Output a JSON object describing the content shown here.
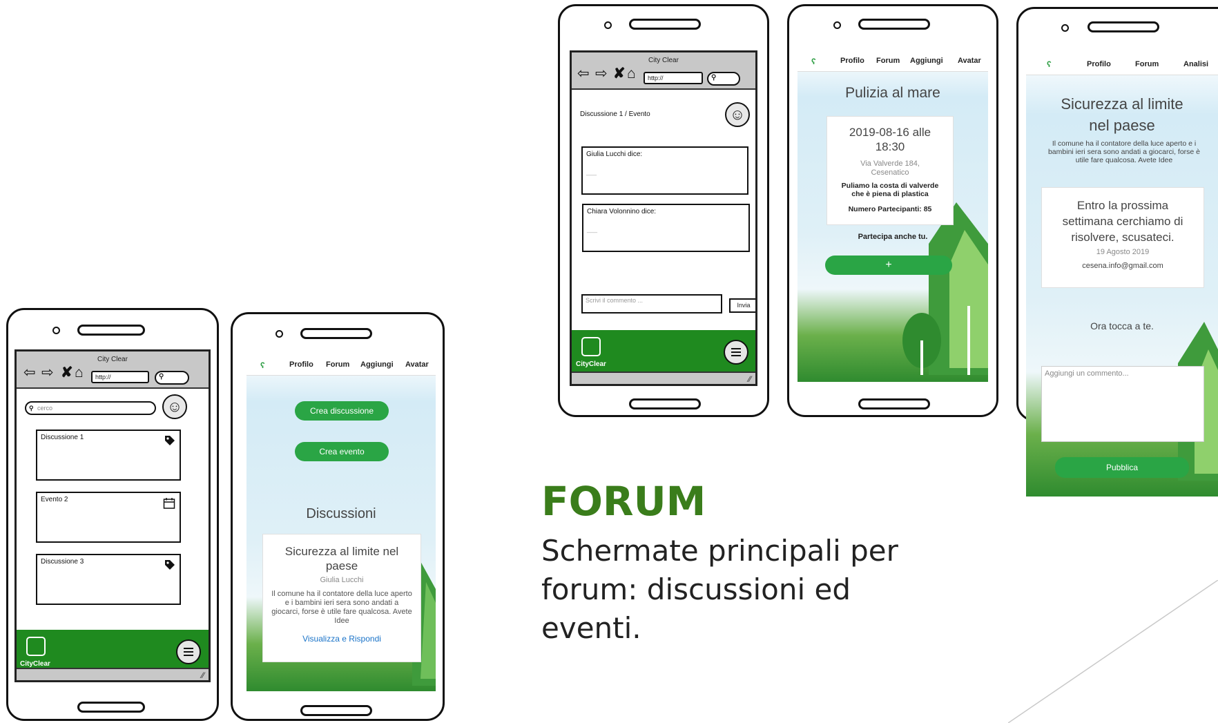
{
  "slide": {
    "heading": "FORUM",
    "subtitle_lines": [
      "Schermate principali per",
      "forum: discussioni ed",
      "eventi."
    ]
  },
  "colors": {
    "accent_green": "#2aa545",
    "wire_green": "#1f8a1f",
    "heading_green": "#3a7d1b"
  },
  "wireframe_list": {
    "app_title": "City Clear",
    "url": "http://",
    "search_placeholder": "cerco",
    "items": [
      {
        "label": "Discussione 1",
        "icon": "tag-icon"
      },
      {
        "label": "Evento 2",
        "icon": "calendar-icon"
      },
      {
        "label": "Discussione 3",
        "icon": "tag-icon"
      }
    ],
    "brand": "CityClear"
  },
  "mock_list": {
    "nav": [
      "Profilo",
      "Forum",
      "Aggiungi",
      "Avatar"
    ],
    "btn_discussion": "Crea discussione",
    "btn_event": "Crea evento",
    "section_title": "Discussioni",
    "card": {
      "title": "Sicurezza al limite nel paese",
      "author": "Giulia Lucchi",
      "body": "Il comune ha il contatore della luce aperto e i bambini ieri sera sono andati a giocarci, forse è utile fare qualcosa. Avete Idee",
      "link": "Visualizza e Rispondi"
    }
  },
  "wireframe_thread": {
    "app_title": "City Clear",
    "url": "http://",
    "breadcrumb": "Discussione 1 / Evento",
    "comments": [
      {
        "author": "Giulia Lucchi dice:",
        "placeholder": "___"
      },
      {
        "author": "Chiara Volonnino dice:",
        "placeholder": "___"
      }
    ],
    "comment_placeholder": "Scrivi il commento ...",
    "send_label": "Invia",
    "brand": "CityClear"
  },
  "mock_event": {
    "nav": [
      "Profilo",
      "Forum",
      "Aggiungi",
      "Avatar"
    ],
    "title": "Pulizia al mare",
    "datetime_line1": "2019-08-16 alle",
    "datetime_line2": "18:30",
    "address_line1": "Via Valverde 184,",
    "address_line2": "Cesenatico",
    "desc_line1": "Puliamo la costa di valverde",
    "desc_line2": "che è piena di plastica",
    "participants": "Numero Partecipanti: 85",
    "cta_text": "Partecipa anche tu.",
    "plus": "+"
  },
  "mock_detail": {
    "nav": [
      "Profilo",
      "Forum",
      "Analisi"
    ],
    "title_line1": "Sicurezza al limite",
    "title_line2": "nel paese",
    "desc": "Il comune ha il contatore della luce aperto e i bambini ieri sera sono andati a giocarci, forse è utile fare qualcosa. Avete Idee",
    "reply_line1": "Entro la prossima",
    "reply_line2": "settimana cerchiamo di",
    "reply_line3": "risolvere, scusateci.",
    "reply_date": "19 Agosto 2019",
    "reply_email": "cesena.info@gmail.com",
    "prompt": "Ora tocca a te.",
    "comment_placeholder": "Aggiungi un commento...",
    "publish": "Pubblica"
  }
}
